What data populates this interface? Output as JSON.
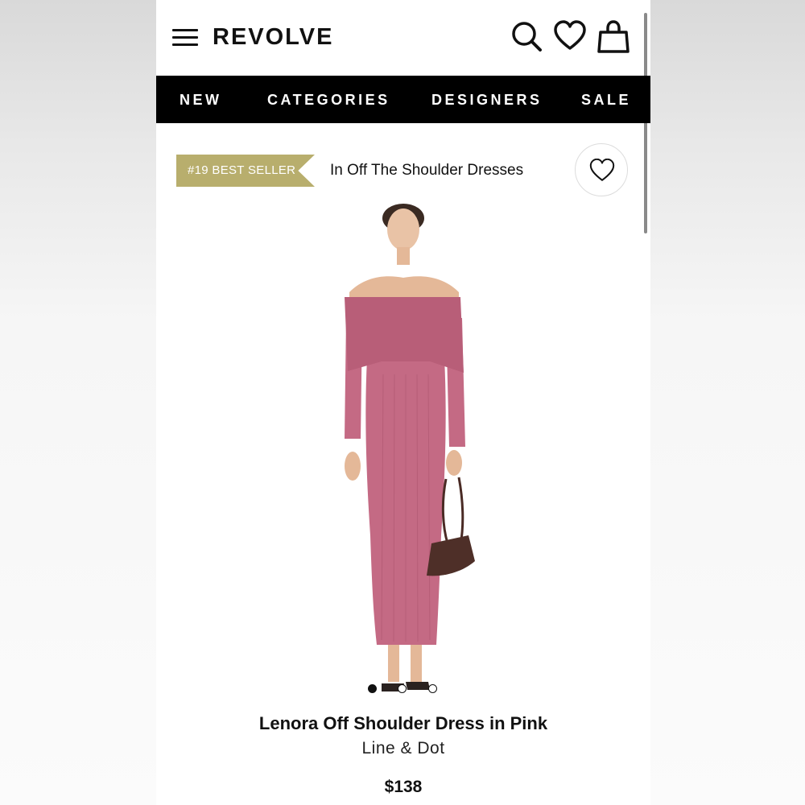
{
  "header": {
    "logo": "REVOLVE",
    "icons": [
      "menu-icon",
      "search-icon",
      "heart-icon",
      "shopping-bag-icon"
    ]
  },
  "nav": {
    "items": [
      {
        "label": "NEW"
      },
      {
        "label": "CATEGORIES"
      },
      {
        "label": "DESIGNERS"
      },
      {
        "label": "SALE"
      }
    ]
  },
  "badge": {
    "label": "#19 BEST SELLER",
    "category_text": "In Off The Shoulder Dresses",
    "color": "#b8ae6d"
  },
  "product": {
    "name": "Lenora Off Shoulder Dress in Pink",
    "brand": "Line & Dot",
    "price": "$138",
    "image_alt": "model wearing pink off shoulder knit maxi dress holding brown handbag",
    "dress_color": "#c46a84",
    "carousel": {
      "total": 3,
      "active": 1
    }
  }
}
